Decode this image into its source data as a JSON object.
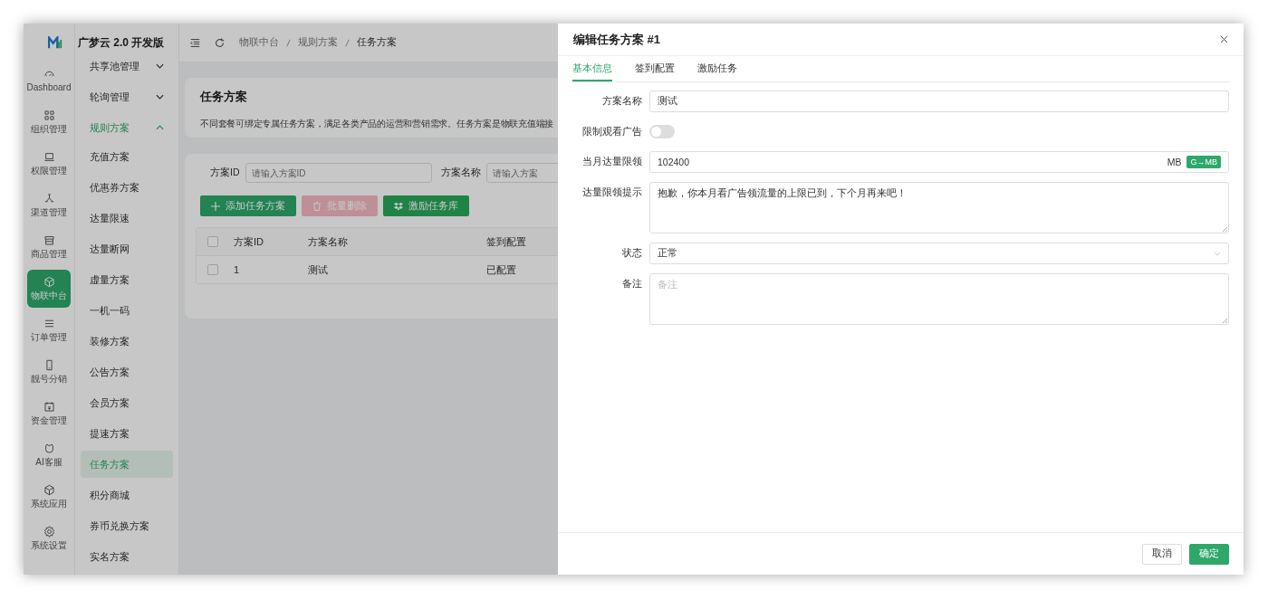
{
  "app": {
    "brand": "广梦云 2.0 开发版"
  },
  "rail": [
    {
      "label": "Dashboard",
      "selected": false
    },
    {
      "label": "组织管理",
      "selected": false
    },
    {
      "label": "权限管理",
      "selected": false
    },
    {
      "label": "渠道管理",
      "selected": false
    },
    {
      "label": "商品管理",
      "selected": false
    },
    {
      "label": "物联中台",
      "selected": true
    },
    {
      "label": "订单管理",
      "selected": false
    },
    {
      "label": "靓号分销",
      "selected": false
    },
    {
      "label": "资金管理",
      "selected": false
    },
    {
      "label": "AI客服",
      "selected": false
    },
    {
      "label": "系统应用",
      "selected": false
    },
    {
      "label": "系统设置",
      "selected": false
    }
  ],
  "submenu": [
    {
      "label": "共享池管理",
      "expanded": false,
      "selected": false
    },
    {
      "label": "轮询管理",
      "expanded": false,
      "selected": false
    },
    {
      "label": "规则方案",
      "expanded": true,
      "selected": true,
      "children": [
        {
          "label": "充值方案",
          "selected": false
        },
        {
          "label": "优惠券方案",
          "selected": false
        },
        {
          "label": "达量限速",
          "selected": false
        },
        {
          "label": "达量断网",
          "selected": false
        },
        {
          "label": "虚量方案",
          "selected": false
        },
        {
          "label": "一机一码",
          "selected": false
        },
        {
          "label": "装修方案",
          "selected": false
        },
        {
          "label": "公告方案",
          "selected": false
        },
        {
          "label": "会员方案",
          "selected": false
        },
        {
          "label": "提速方案",
          "selected": false
        },
        {
          "label": "任务方案",
          "selected": true
        },
        {
          "label": "积分商城",
          "selected": false
        },
        {
          "label": "券币兑换方案",
          "selected": false
        },
        {
          "label": "实名方案",
          "selected": false
        }
      ]
    }
  ],
  "breadcrumb": [
    "物联中台",
    "规则方案",
    "任务方案"
  ],
  "page": {
    "title": "任务方案",
    "description": "不同套餐可绑定专属任务方案，满足各类产品的运营和营销需求。任务方案是物联充值端接"
  },
  "filters": [
    {
      "label": "方案ID",
      "placeholder": "请输入方案ID"
    },
    {
      "label": "方案名称",
      "placeholder": "请输入方案"
    }
  ],
  "actions": [
    {
      "label": "添加任务方案",
      "kind": "add",
      "disabled": false
    },
    {
      "label": "批量删除",
      "kind": "delete",
      "disabled": true
    },
    {
      "label": "激励任务库",
      "kind": "library",
      "disabled": false
    }
  ],
  "table": {
    "columns": [
      "方案ID",
      "方案名称",
      "签到配置"
    ],
    "header_checked": false,
    "rows": [
      {
        "checked": false,
        "cells": [
          "1",
          "测试",
          "已配置"
        ]
      }
    ]
  },
  "drawer": {
    "title": "编辑任务方案 #1",
    "tabs": [
      {
        "label": "基本信息",
        "selected": true
      },
      {
        "label": "签到配置",
        "selected": false
      },
      {
        "label": "激励任务",
        "selected": false
      }
    ],
    "fields": [
      {
        "kind": "text",
        "label": "方案名称",
        "value": "测试"
      },
      {
        "kind": "switch",
        "label": "限制观看广告",
        "on": false
      },
      {
        "kind": "unit",
        "label": "当月达量限领",
        "value": "102400",
        "unit": "MB",
        "action": "G→MB"
      },
      {
        "kind": "textarea",
        "label": "达量限领提示",
        "value": "抱歉，你本月看广告领流量的上限已到，下个月再来吧！"
      },
      {
        "kind": "select",
        "label": "状态",
        "value": "正常"
      },
      {
        "kind": "textarea",
        "label": "备注",
        "placeholder": "备注"
      }
    ],
    "buttons": [
      {
        "label": "取消",
        "kind": "default"
      },
      {
        "label": "确定",
        "kind": "primary"
      }
    ]
  }
}
